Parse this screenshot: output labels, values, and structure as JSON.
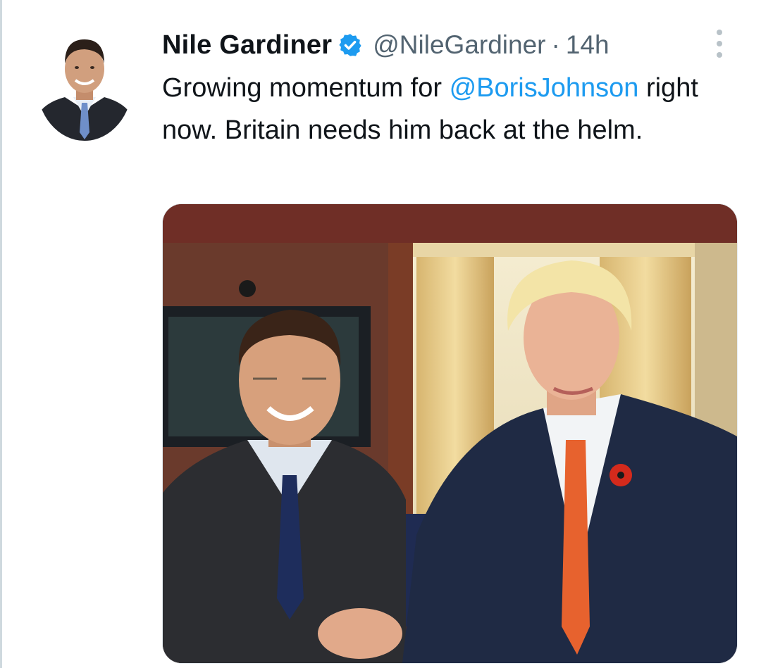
{
  "tweet": {
    "author_name": "Nile Gardiner",
    "handle": "@NileGardiner",
    "separator": "·",
    "time": "14h",
    "text_before_mention": "Growing momentum for ",
    "mention": "@BorisJohnson",
    "text_after_mention": " right now. Britain needs him back at the helm."
  },
  "icons": {
    "verified": "verified-badge-icon",
    "more": "more-options-icon"
  },
  "colors": {
    "link": "#1d9bf0",
    "secondary_text": "#536471",
    "verified_badge": "#1d9bf0"
  }
}
